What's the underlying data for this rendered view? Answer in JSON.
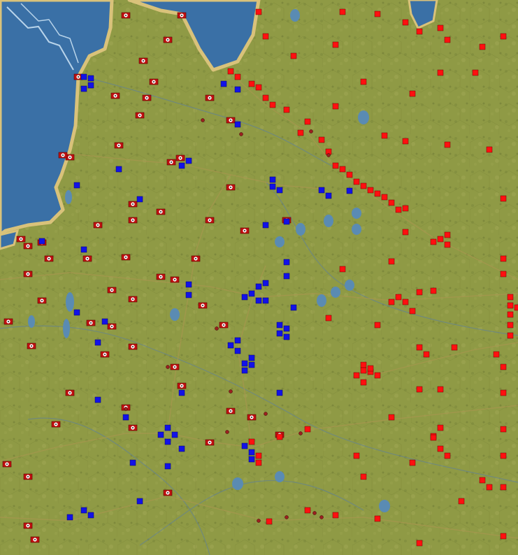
{
  "colors": {
    "land": "#8f9a45",
    "land_dark": "#6f7d35",
    "land_light": "#a8ad5c",
    "sea": "#3a70a6",
    "coast": "#d9c27a",
    "lake": "#5a8bb3",
    "axis_flag": "#c01010",
    "axis_emblem": "#ffffff",
    "allied_unit": "#1212e8",
    "soviet_unit": "#ff1010"
  },
  "icons": {
    "german_unit": "axis-unit-flag-icon",
    "allied_unit": "blue-unit-counter-icon",
    "soviet_unit": "red-unit-counter-icon",
    "soviet_flag": "soviet-flag-icon",
    "city": "city-marker-icon",
    "lake": "lake-icon"
  }
}
